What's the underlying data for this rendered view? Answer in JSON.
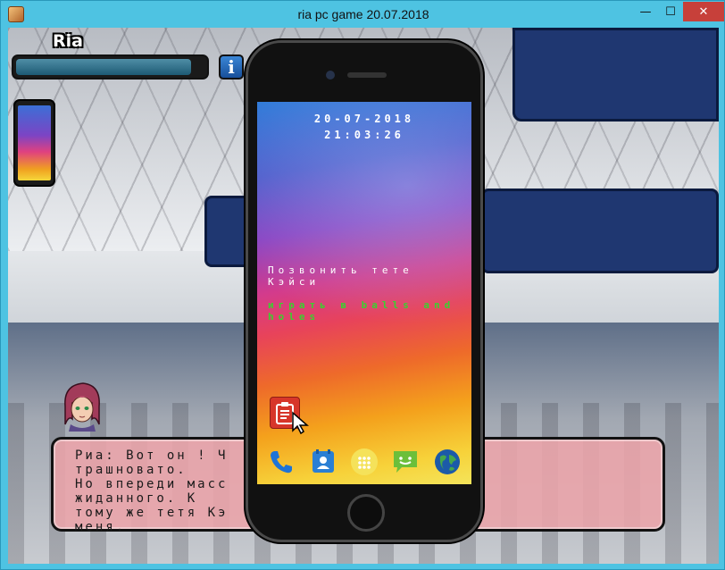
{
  "window": {
    "title": "ria pc game 20.07.2018",
    "minimize_glyph": "—",
    "maximize_glyph": "☐",
    "close_glyph": "✕"
  },
  "hud": {
    "character_name": "Ria",
    "health_fraction": 0.93,
    "info_glyph": "i"
  },
  "phone": {
    "date": "20-07-2018",
    "time": "21:03:26",
    "menu": {
      "call_label": "Позвонить тете Кэйси",
      "play_label": "играть в balls and holes"
    },
    "dock_icons": [
      "phone-icon",
      "contacts-icon",
      "apps-icon",
      "messages-icon",
      "browser-icon"
    ],
    "notes_icon": "clipboard-icon"
  },
  "dialogue": {
    "visible_text": "Риа: Вот он ! Ч                                                    трашновато.\nНо впереди масс                                                  жиданного. К\nтому же тетя Кэ                                                  меня."
  },
  "colors": {
    "accent": "#4ec3e2",
    "close": "#c7403a",
    "banner": "#1f3771",
    "dialog_bg": "#eca4aa",
    "play_text": "#39d12f"
  }
}
